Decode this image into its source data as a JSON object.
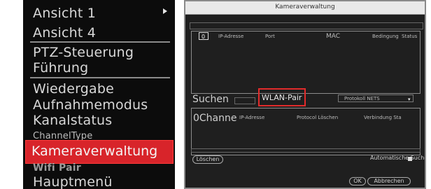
{
  "menu": {
    "items": [
      {
        "label": "Ansicht 1"
      },
      {
        "label": "Ansicht 4"
      },
      {
        "label": "PTZ-Steuerung"
      },
      {
        "label": "Führung"
      },
      {
        "label": "Wiedergabe"
      },
      {
        "label": "Aufnahmemodus"
      },
      {
        "label": "Kanalstatus"
      },
      {
        "label": "ChannelType"
      },
      {
        "label": "Kameraverwaltung"
      },
      {
        "label": "Wifi Pair"
      },
      {
        "label": "Hauptmenü"
      }
    ]
  },
  "dialog": {
    "title": "Kameraverwaltung",
    "list_header": {
      "col_num": "0",
      "col_ip": "IP-Adresse",
      "col_port": "Port",
      "col_mac": "MAC",
      "col_proto": "Bedingung",
      "col_status": "Status"
    },
    "search_button": "Suchen",
    "wlan_pair_button": "WLAN-Pair",
    "protocol_label": "Protokoll NETS",
    "added_header": {
      "col_channel": "0Channe",
      "col_ip": "IP-Adresse",
      "col_delete_proto": "Protocol Löschen",
      "col_conn": "Verbindung Sta"
    },
    "delete_button": "Löschen",
    "auto_search_label": "Automatische Suche",
    "ok_button": "OK",
    "cancel_button": "Abbrechen"
  }
}
